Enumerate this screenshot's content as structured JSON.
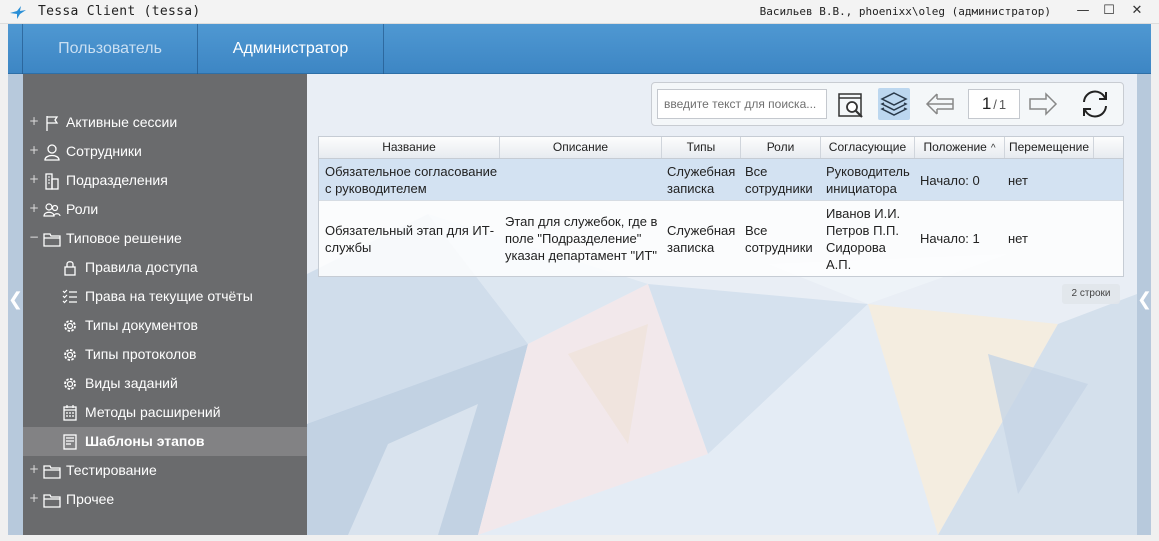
{
  "window": {
    "title": "Tessa Client (tessa)",
    "user_info": "Васильев В.В., phoenixx\\oleg (администратор)",
    "minimize": "—",
    "maximize": "☐",
    "close": "✕"
  },
  "top_tabs": {
    "user": "Пользователь",
    "admin": "Администратор"
  },
  "side_arrows": {
    "left": "❮",
    "right": "❮"
  },
  "sidebar": {
    "items": [
      {
        "label": "Активные сессии",
        "expander": "+",
        "icon": "flag-icon"
      },
      {
        "label": "Сотрудники",
        "expander": "+",
        "icon": "person-icon"
      },
      {
        "label": "Подразделения",
        "expander": "+",
        "icon": "building-icon"
      },
      {
        "label": "Роли",
        "expander": "+",
        "icon": "people-icon"
      },
      {
        "label": "Типовое решение",
        "expander": "−",
        "icon": "folder-icon"
      },
      {
        "label": "Правила доступа",
        "icon": "lock-icon"
      },
      {
        "label": "Права на текущие отчёты",
        "icon": "checklist-icon"
      },
      {
        "label": "Типы документов",
        "icon": "gear-icon"
      },
      {
        "label": "Типы протоколов",
        "icon": "gear-icon"
      },
      {
        "label": "Виды заданий",
        "icon": "gear-icon"
      },
      {
        "label": "Методы расширений",
        "icon": "calendar-icon"
      },
      {
        "label": "Шаблоны этапов",
        "icon": "document-icon"
      },
      {
        "label": "Тестирование",
        "expander": "+",
        "icon": "folder-icon"
      },
      {
        "label": "Прочее",
        "expander": "+",
        "icon": "folder-icon"
      }
    ]
  },
  "toolbar": {
    "search_placeholder": "введите текст для поиска...",
    "page_current": "1",
    "page_separator": "/",
    "page_total": "1"
  },
  "table": {
    "columns": [
      "Название",
      "Описание",
      "Типы",
      "Роли",
      "Согласующие",
      "Положение",
      "Перемещение"
    ],
    "sort_indicator": "^",
    "rows": [
      {
        "name": "Обязательное согласование с руководителем",
        "description": "",
        "types": "Служебная записка",
        "roles": "Все сотрудники",
        "approvers": "Руководитель инициатора",
        "position": "Начало: 0",
        "movement": "нет"
      },
      {
        "name": "Обязательный этап для ИТ-службы",
        "description": "Этап для служебок, где в поле \"Подразделение\" указан департамент \"ИТ\"",
        "types": "Служебная записка",
        "roles": "Все сотрудники",
        "approvers": "Иванов И.И. Петров П.П. Сидорова А.П.",
        "position": "Начало: 1",
        "movement": "нет"
      }
    ]
  },
  "row_count": "2 строки",
  "colors": {
    "topbar": "#4590cc",
    "sidebar": "#464646",
    "selected_row": "#cddef0",
    "layers_button": "#bcd7ef"
  }
}
